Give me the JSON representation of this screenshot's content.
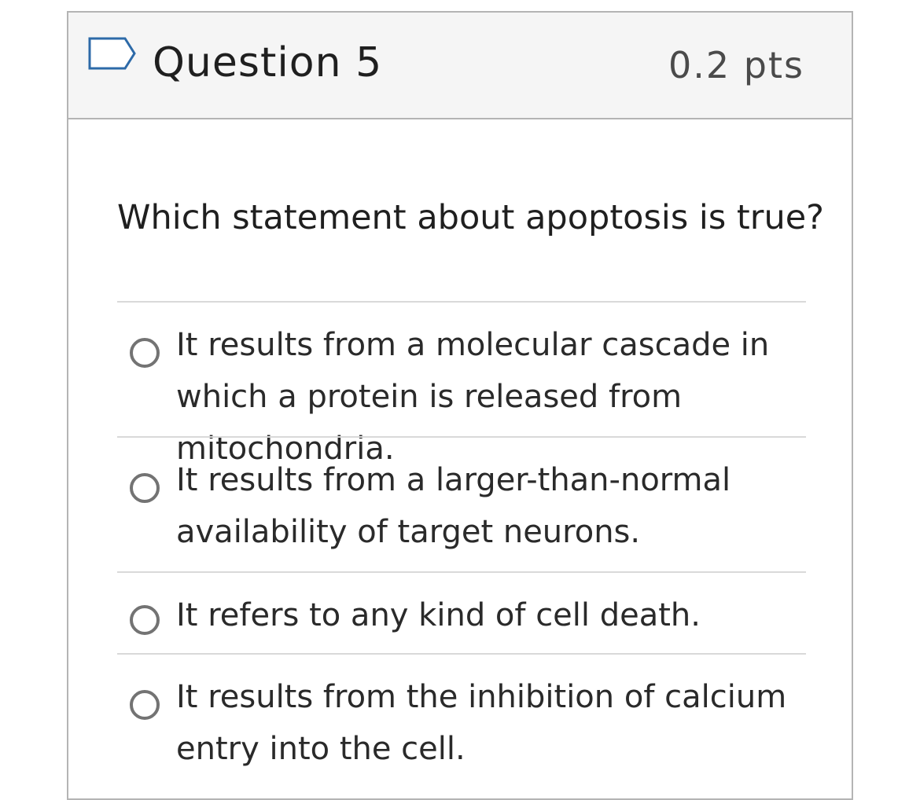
{
  "question": {
    "title": "Question 5",
    "points": "0.2 pts",
    "text": "Which statement about apoptosis is true?",
    "flag_icon": "flag-outline-icon",
    "accent_color": "#2d6aa8"
  },
  "answers": [
    {
      "label": "It results from a molecular cascade in which a protein is released from mitochondria.",
      "selected": false
    },
    {
      "label": "It results from a larger-than-normal availability of target neurons.",
      "selected": false
    },
    {
      "label": "It refers to any kind of cell death.",
      "selected": false
    },
    {
      "label": "It results from the inhibition of calcium entry into the cell.",
      "selected": false
    }
  ]
}
